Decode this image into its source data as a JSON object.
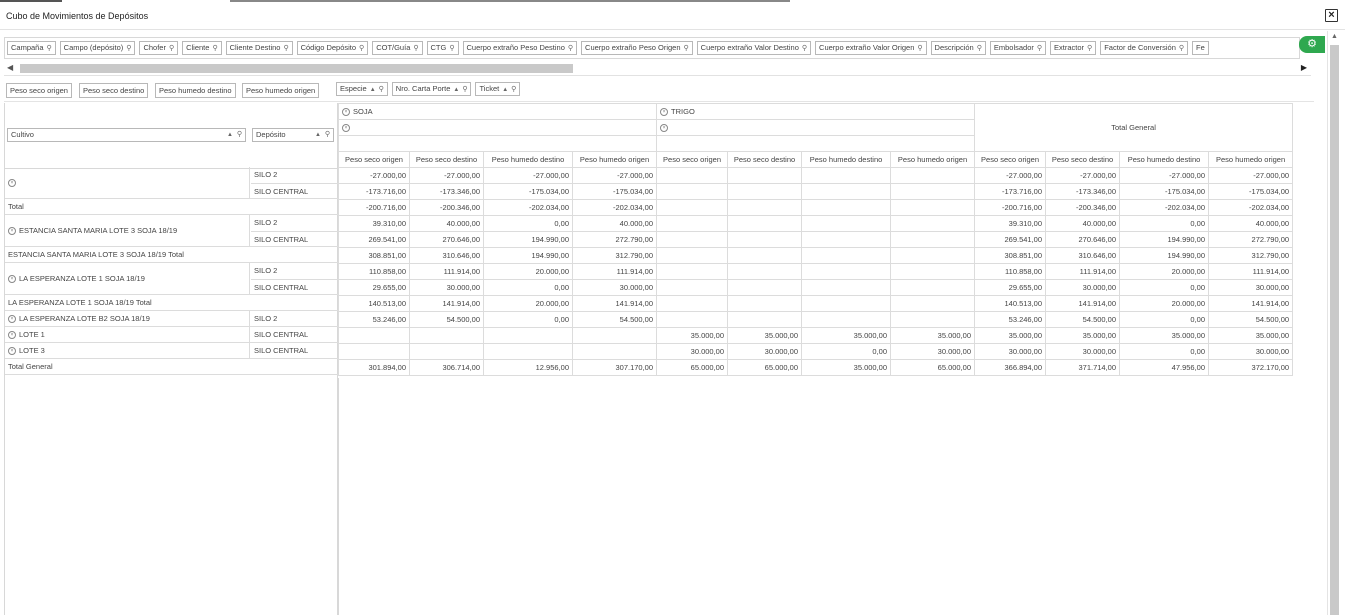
{
  "window": {
    "title": "Cubo de Movimientos de Depósitos",
    "close_icon": "×"
  },
  "filter_fields": [
    "Campaña",
    "Campo (depósito)",
    "Chofer",
    "Cliente",
    "Cliente Destino",
    "Código Depósito",
    "COT/Guía",
    "CTG",
    "Cuerpo extraño Peso Destino",
    "Cuerpo extraño Peso Origen",
    "Cuerpo extraño Valor Destino",
    "Cuerpo extraño Valor Origen",
    "Descripción",
    "Embolsador",
    "Extractor",
    "Factor de Conversión",
    "Fe"
  ],
  "data_fields": [
    "Peso seco origen",
    "Peso seco destino",
    "Peso humedo destino",
    "Peso humedo origen"
  ],
  "column_fields": [
    "Especie",
    "Nro. Carta Porte",
    "Ticket"
  ],
  "row_fields": [
    "Cultivo",
    "Depósito"
  ],
  "column_groups": [
    {
      "label": "SOJA"
    },
    {
      "label": "TRIGO"
    }
  ],
  "grand_total_label": "Total General",
  "measure_headers": [
    "Peso seco origen",
    "Peso seco destino",
    "Peso humedo destino",
    "Peso humedo origen"
  ],
  "rows": [
    {
      "cultivo": "",
      "deposito": "SILO 2",
      "soja": [
        "-27.000,00",
        "-27.000,00",
        "-27.000,00",
        "-27.000,00"
      ],
      "trigo": [
        "",
        "",
        "",
        ""
      ],
      "total": [
        "-27.000,00",
        "-27.000,00",
        "-27.000,00",
        "-27.000,00"
      ]
    },
    {
      "cultivo": "",
      "deposito": "SILO CENTRAL",
      "soja": [
        "-173.716,00",
        "-173.346,00",
        "-175.034,00",
        "-175.034,00"
      ],
      "trigo": [
        "",
        "",
        "",
        ""
      ],
      "total": [
        "-173.716,00",
        "-173.346,00",
        "-175.034,00",
        "-175.034,00"
      ]
    },
    {
      "cultivo": "Total",
      "deposito": "",
      "soja": [
        "-200.716,00",
        "-200.346,00",
        "-202.034,00",
        "-202.034,00"
      ],
      "trigo": [
        "",
        "",
        "",
        ""
      ],
      "total": [
        "-200.716,00",
        "-200.346,00",
        "-202.034,00",
        "-202.034,00"
      ]
    },
    {
      "cultivo": "ESTANCIA SANTA MARIA LOTE 3 SOJA 18/19",
      "deposito": "SILO 2",
      "soja": [
        "39.310,00",
        "40.000,00",
        "0,00",
        "40.000,00"
      ],
      "trigo": [
        "",
        "",
        "",
        ""
      ],
      "total": [
        "39.310,00",
        "40.000,00",
        "0,00",
        "40.000,00"
      ]
    },
    {
      "cultivo": "",
      "deposito": "SILO CENTRAL",
      "soja": [
        "269.541,00",
        "270.646,00",
        "194.990,00",
        "272.790,00"
      ],
      "trigo": [
        "",
        "",
        "",
        ""
      ],
      "total": [
        "269.541,00",
        "270.646,00",
        "194.990,00",
        "272.790,00"
      ]
    },
    {
      "cultivo": "ESTANCIA SANTA MARIA LOTE 3 SOJA 18/19 Total",
      "deposito": "",
      "soja": [
        "308.851,00",
        "310.646,00",
        "194.990,00",
        "312.790,00"
      ],
      "trigo": [
        "",
        "",
        "",
        ""
      ],
      "total": [
        "308.851,00",
        "310.646,00",
        "194.990,00",
        "312.790,00"
      ]
    },
    {
      "cultivo": "LA ESPERANZA LOTE 1 SOJA 18/19",
      "deposito": "SILO 2",
      "soja": [
        "110.858,00",
        "111.914,00",
        "20.000,00",
        "111.914,00"
      ],
      "trigo": [
        "",
        "",
        "",
        ""
      ],
      "total": [
        "110.858,00",
        "111.914,00",
        "20.000,00",
        "111.914,00"
      ]
    },
    {
      "cultivo": "",
      "deposito": "SILO CENTRAL",
      "soja": [
        "29.655,00",
        "30.000,00",
        "0,00",
        "30.000,00"
      ],
      "trigo": [
        "",
        "",
        "",
        ""
      ],
      "total": [
        "29.655,00",
        "30.000,00",
        "0,00",
        "30.000,00"
      ]
    },
    {
      "cultivo": "LA ESPERANZA LOTE 1 SOJA 18/19 Total",
      "deposito": "",
      "soja": [
        "140.513,00",
        "141.914,00",
        "20.000,00",
        "141.914,00"
      ],
      "trigo": [
        "",
        "",
        "",
        ""
      ],
      "total": [
        "140.513,00",
        "141.914,00",
        "20.000,00",
        "141.914,00"
      ]
    },
    {
      "cultivo": "LA ESPERANZA LOTE B2 SOJA 18/19",
      "deposito": "SILO 2",
      "soja": [
        "53.246,00",
        "54.500,00",
        "0,00",
        "54.500,00"
      ],
      "trigo": [
        "",
        "",
        "",
        ""
      ],
      "total": [
        "53.246,00",
        "54.500,00",
        "0,00",
        "54.500,00"
      ]
    },
    {
      "cultivo": "LOTE 1",
      "deposito": "SILO CENTRAL",
      "soja": [
        "",
        "",
        "",
        ""
      ],
      "trigo": [
        "35.000,00",
        "35.000,00",
        "35.000,00",
        "35.000,00"
      ],
      "total": [
        "35.000,00",
        "35.000,00",
        "35.000,00",
        "35.000,00"
      ]
    },
    {
      "cultivo": "LOTE 3",
      "deposito": "SILO CENTRAL",
      "soja": [
        "",
        "",
        "",
        ""
      ],
      "trigo": [
        "30.000,00",
        "30.000,00",
        "0,00",
        "30.000,00"
      ],
      "total": [
        "30.000,00",
        "30.000,00",
        "0,00",
        "30.000,00"
      ]
    },
    {
      "cultivo": "Total General",
      "deposito": "",
      "soja": [
        "301.894,00",
        "306.714,00",
        "12.956,00",
        "307.170,00"
      ],
      "trigo": [
        "65.000,00",
        "65.000,00",
        "35.000,00",
        "65.000,00"
      ],
      "total": [
        "366.894,00",
        "371.714,00",
        "47.956,00",
        "372.170,00"
      ]
    }
  ],
  "icons": {
    "filter": "funnel-icon",
    "sort": "sort-asc-icon",
    "collapse": "collapse-circle-icon",
    "settings": "pivot-settings-icon"
  },
  "colors": {
    "accent_green": "#2fa84f",
    "border": "#dcdcdc"
  }
}
